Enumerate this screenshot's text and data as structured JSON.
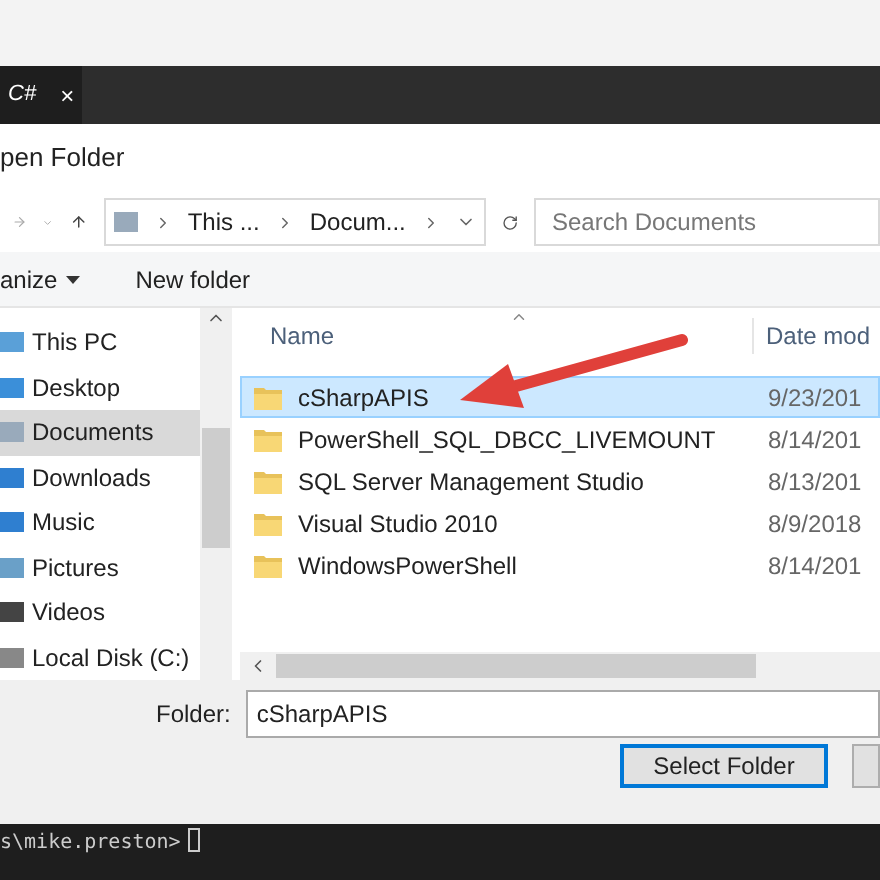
{
  "editor_tab": {
    "label": "C#",
    "close": "×"
  },
  "dialog": {
    "title": "pen Folder",
    "address": {
      "crumbs": [
        "This ...",
        "Docum..."
      ]
    },
    "search": {
      "placeholder": "Search Documents"
    },
    "toolbar": {
      "organize": "anize",
      "new_folder": "New folder"
    },
    "sidebar": [
      {
        "label": "This PC",
        "kind": "pc",
        "selected": false
      },
      {
        "label": "Desktop",
        "kind": "desktop",
        "selected": false
      },
      {
        "label": "Documents",
        "kind": "documents",
        "selected": true
      },
      {
        "label": "Downloads",
        "kind": "downloads",
        "selected": false
      },
      {
        "label": "Music",
        "kind": "music",
        "selected": false
      },
      {
        "label": "Pictures",
        "kind": "pictures",
        "selected": false
      },
      {
        "label": "Videos",
        "kind": "videos",
        "selected": false
      },
      {
        "label": "Local Disk (C:)",
        "kind": "disk",
        "selected": false
      }
    ],
    "columns": [
      "Name",
      "Date mod"
    ],
    "rows": [
      {
        "name": "cSharpAPIS",
        "date": "9/23/201",
        "selected": true
      },
      {
        "name": "PowerShell_SQL_DBCC_LIVEMOUNT",
        "date": "8/14/201",
        "selected": false
      },
      {
        "name": "SQL Server Management Studio",
        "date": "8/13/201",
        "selected": false
      },
      {
        "name": "Visual Studio 2010",
        "date": "8/9/2018",
        "selected": false
      },
      {
        "name": "WindowsPowerShell",
        "date": "8/14/201",
        "selected": false
      }
    ],
    "folder_label": "Folder:",
    "folder_value": "cSharpAPIS",
    "select_button": "Select Folder"
  },
  "terminal": {
    "prompt": "s\\mike.preston>"
  }
}
